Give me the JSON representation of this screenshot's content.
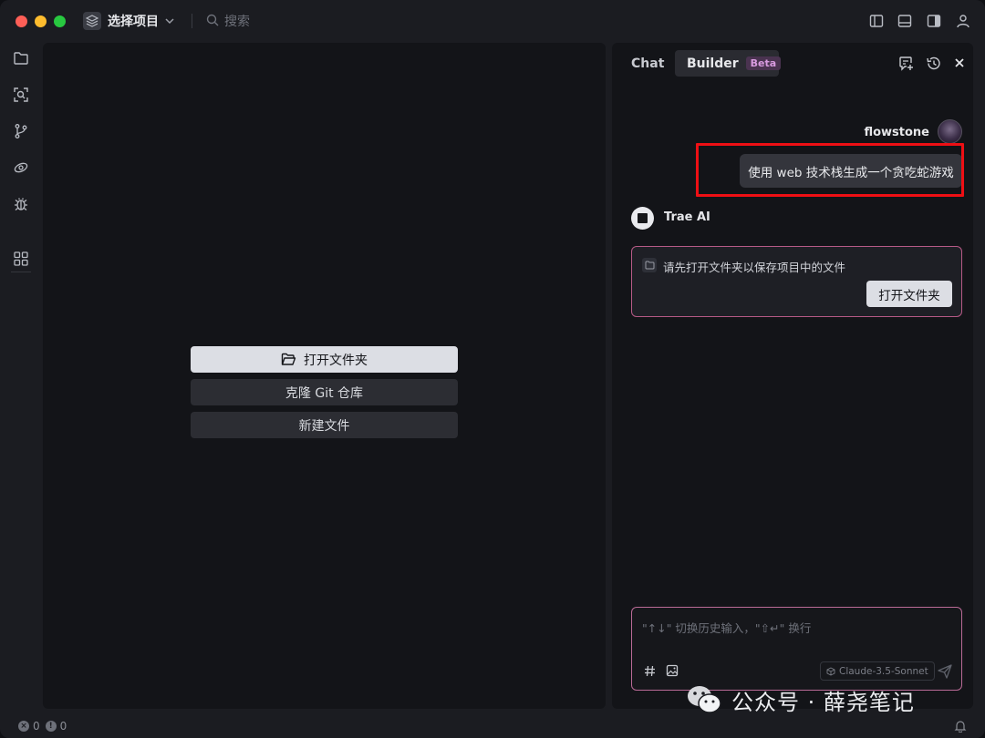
{
  "titlebar": {
    "project_label": "选择项目",
    "search_placeholder": "搜索"
  },
  "welcome": {
    "open_folder": "打开文件夹",
    "clone_git": "克隆 Git 仓库",
    "new_file": "新建文件"
  },
  "chat": {
    "tabs": [
      {
        "label": "Chat",
        "active": false
      },
      {
        "label": "Builder",
        "active": true,
        "badge": "Beta"
      }
    ],
    "user_name": "flowstone",
    "user_message": "使用 web 技术栈生成一个贪吃蛇游戏",
    "ai_name": "Trae AI",
    "notice_text": "请先打开文件夹以保存项目中的文件",
    "notice_button": "打开文件夹",
    "input_placeholder": "\"↑↓\" 切换历史输入，\"⇧↵\" 换行",
    "model": "Claude-3.5-Sonnet"
  },
  "statusbar": {
    "errors": "0",
    "warnings": "0"
  },
  "watermark": {
    "text": "公众号 · 薛尧笔记"
  },
  "colors": {
    "highlight": "#ee0f14",
    "accent_border": "#b65a86",
    "beta": "#d99be0"
  }
}
